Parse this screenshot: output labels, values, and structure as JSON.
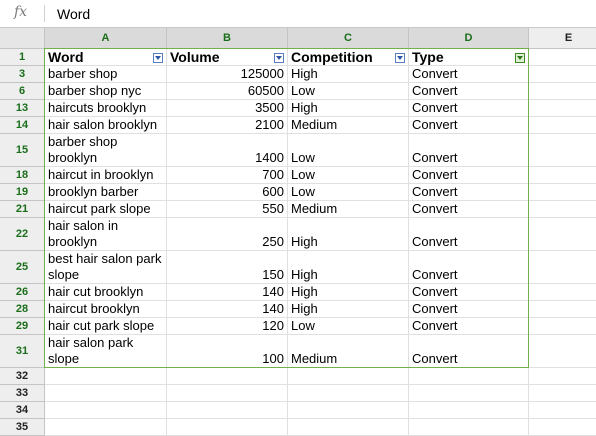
{
  "formula_bar": {
    "icon": "fx",
    "value": "Word"
  },
  "columns": [
    "A",
    "B",
    "C",
    "D",
    "E"
  ],
  "header_row": {
    "row_number": "1",
    "cells": [
      "Word",
      "Volume",
      "Competition",
      "Type"
    ]
  },
  "rows": [
    {
      "row_number": "3",
      "word": "barber shop",
      "volume": "125000",
      "competition": "High",
      "type": "Convert"
    },
    {
      "row_number": "6",
      "word": "barber shop nyc",
      "volume": "60500",
      "competition": "Low",
      "type": "Convert"
    },
    {
      "row_number": "13",
      "word": "haircuts brooklyn",
      "volume": "3500",
      "competition": "High",
      "type": "Convert"
    },
    {
      "row_number": "14",
      "word": "hair salon brooklyn",
      "volume": "2100",
      "competition": "Medium",
      "type": "Convert"
    },
    {
      "row_number": "15",
      "word": "barber shop brooklyn",
      "volume": "1400",
      "competition": "Low",
      "type": "Convert"
    },
    {
      "row_number": "18",
      "word": "haircut in brooklyn",
      "volume": "700",
      "competition": "Low",
      "type": "Convert"
    },
    {
      "row_number": "19",
      "word": "brooklyn barber",
      "volume": "600",
      "competition": "Low",
      "type": "Convert"
    },
    {
      "row_number": "21",
      "word": "haircut park slope",
      "volume": "550",
      "competition": "Medium",
      "type": "Convert"
    },
    {
      "row_number": "22",
      "word": "hair salon in brooklyn",
      "volume": "250",
      "competition": "High",
      "type": "Convert"
    },
    {
      "row_number": "25",
      "word": "best hair salon park slope",
      "volume": "150",
      "competition": "High",
      "type": "Convert"
    },
    {
      "row_number": "26",
      "word": "hair cut brooklyn",
      "volume": "140",
      "competition": "High",
      "type": "Convert"
    },
    {
      "row_number": "28",
      "word": "haircut brooklyn",
      "volume": "140",
      "competition": "High",
      "type": "Convert"
    },
    {
      "row_number": "29",
      "word": "hair cut park slope",
      "volume": "120",
      "competition": "Low",
      "type": "Convert"
    },
    {
      "row_number": "31",
      "word": "hair salon park slope",
      "volume": "100",
      "competition": "Medium",
      "type": "Convert"
    }
  ],
  "empty_rows": [
    "32",
    "33",
    "34",
    "35"
  ],
  "colors": {
    "selection_green": "#6fb24a",
    "filter_blue": "#2f56a6"
  }
}
